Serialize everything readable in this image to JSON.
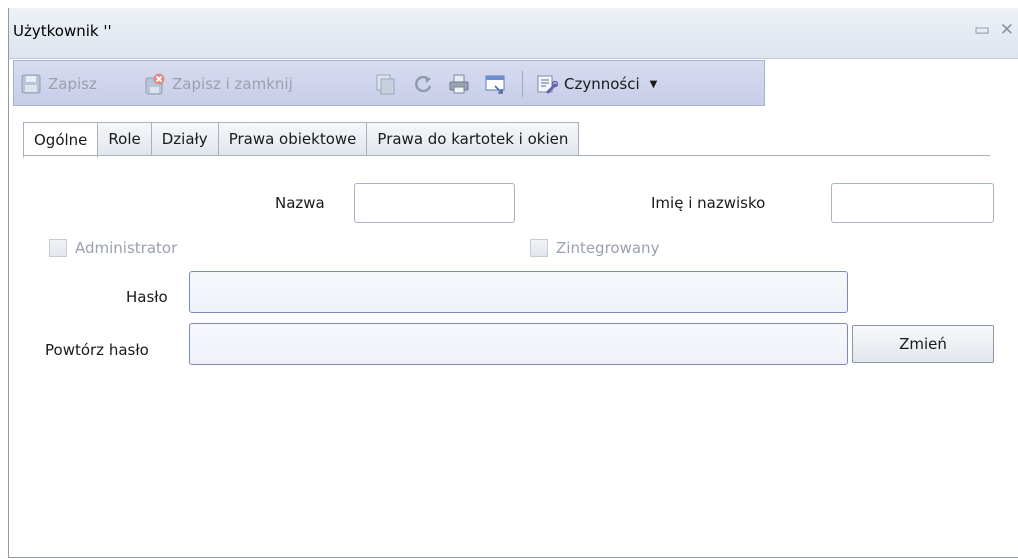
{
  "window": {
    "title": "Użytkownik ''",
    "maximize_glyph": "▭",
    "close_glyph": "✕"
  },
  "toolbar": {
    "save_label": "Zapisz",
    "save_close_label": "Zapisz i zamknij",
    "actions_label": "Czynności",
    "dropdown_glyph": "▼"
  },
  "tabs": [
    {
      "label": "Ogólne",
      "selected": true
    },
    {
      "label": "Role",
      "selected": false
    },
    {
      "label": "Działy",
      "selected": false
    },
    {
      "label": "Prawa obiektowe",
      "selected": false
    },
    {
      "label": "Prawa do kartotek i okien",
      "selected": false
    }
  ],
  "form": {
    "name_label": "Nazwa",
    "name_value": "",
    "fullname_label": "Imię i nazwisko",
    "fullname_value": "",
    "admin_label": "Administrator",
    "admin_checked": false,
    "integrated_label": "Zintegrowany",
    "integrated_checked": false,
    "password_label": "Hasło",
    "password_value": "",
    "repeat_password_label": "Powtórz hasło",
    "repeat_password_value": "",
    "change_button_label": "Zmień"
  },
  "icons": {
    "save": "floppy-icon",
    "save_close": "floppy-close-icon",
    "copy": "copy-icon",
    "refresh": "refresh-icon",
    "print": "printer-icon",
    "preview": "window-preview-icon",
    "actions": "wrench-list-icon"
  },
  "colors": {
    "toolbar_bg": "#c8cde8",
    "disabled_text": "#9aa1ae",
    "input_border_focus": "#7b8bb6"
  }
}
